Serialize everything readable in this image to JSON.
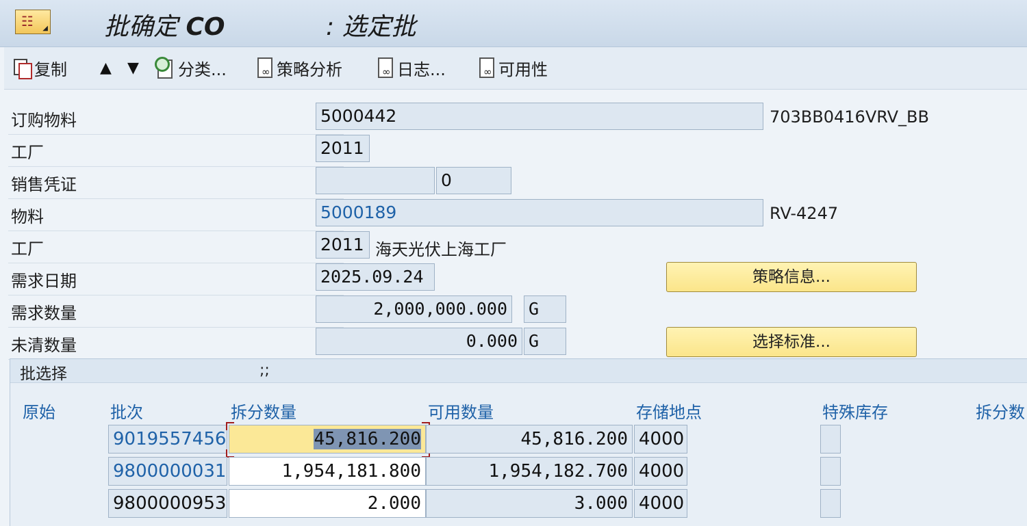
{
  "title": {
    "main": "批确定 ",
    "co": "CO",
    "sub": ": 选定批"
  },
  "toolbar": {
    "copy": "复制",
    "up_arrow": "▲",
    "down_arrow": "▼",
    "classify": "分类...",
    "strategy_analysis": "策略分析",
    "log": "日志...",
    "availability": "可用性"
  },
  "form": {
    "order_material": {
      "label": "订购物料",
      "value": "5000442",
      "desc": "703BB0416VRV_BB"
    },
    "plant1": {
      "label": "工厂",
      "value": "2011"
    },
    "sales_doc": {
      "label": "销售凭证",
      "value": "",
      "item": "0"
    },
    "material": {
      "label": "物料",
      "value": "5000189",
      "desc": "RV-4247"
    },
    "plant2": {
      "label": "工厂",
      "value": "2011",
      "desc": "海天光伏上海工厂"
    },
    "req_date": {
      "label": "需求日期",
      "value": "2025.09.24"
    },
    "req_qty": {
      "label": "需求数量",
      "value": "2,000,000.000",
      "unit": "G"
    },
    "open_qty": {
      "label": "未清数量",
      "value": "0.000",
      "unit": "G"
    }
  },
  "buttons": {
    "strategy_info": "策略信息...",
    "selection_criteria": "选择标准..."
  },
  "batch_section": {
    "title": "批选择",
    "semi": ";;",
    "columns": [
      "原始",
      "批次",
      "拆分数量",
      "可用数量",
      "存储地点",
      "特殊库存",
      "拆分数"
    ],
    "rows": [
      {
        "batch": "9019557456",
        "split_qty": "45,816.200",
        "avail_qty": "45,816.200",
        "storage": "4000"
      },
      {
        "batch": "9800000031",
        "split_qty": "1,954,181.800",
        "avail_qty": "1,954,182.700",
        "storage": "4000"
      },
      {
        "batch": "9800000953",
        "split_qty": "2.000",
        "avail_qty": "3.000",
        "storage": "4000"
      }
    ]
  },
  "colors": {
    "link": "#1f62a8",
    "button_yellow": "#fbe58a",
    "titlebar": "#c9d8e8",
    "selection": "#7f95b3"
  }
}
